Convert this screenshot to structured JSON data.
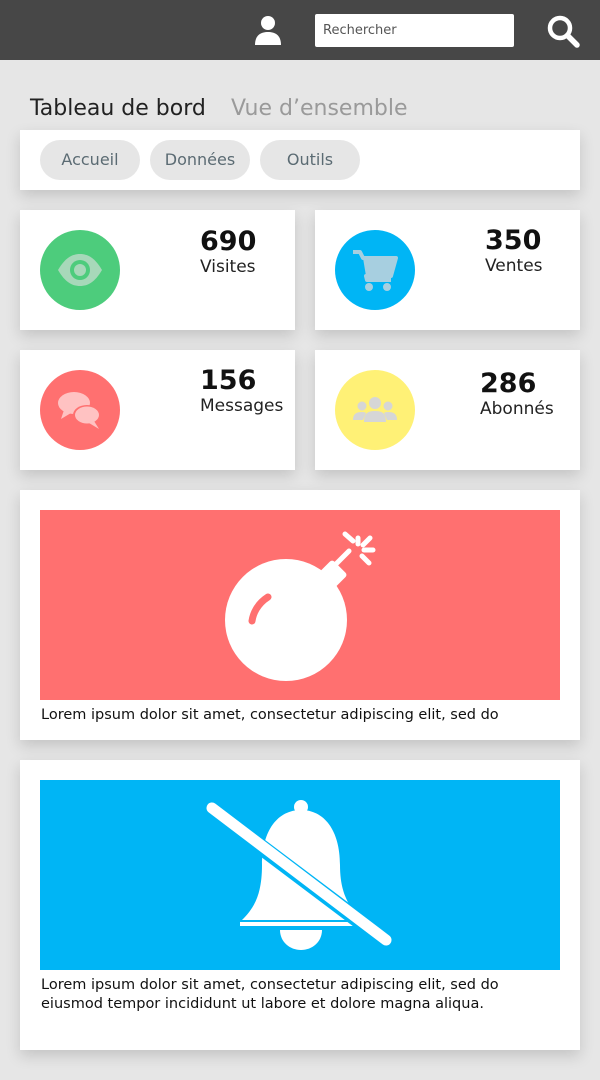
{
  "header": {
    "search_placeholder": "Rechercher",
    "user_icon": "user-icon",
    "search_icon": "search-icon"
  },
  "page": {
    "title": "Tableau de bord",
    "subtitle": "Vue d’ensemble"
  },
  "tabs": [
    {
      "label": "Accueil"
    },
    {
      "label": "Données"
    },
    {
      "label": "Outils"
    }
  ],
  "stats": [
    {
      "value": "690",
      "label": "Visites",
      "icon": "eye-icon",
      "color": "#4dcc7c"
    },
    {
      "value": "350",
      "label": "Ventes",
      "icon": "cart-icon",
      "color": "#00b5f5"
    },
    {
      "value": "156",
      "label": "Messages",
      "icon": "chat-icon",
      "color": "#ff7070"
    },
    {
      "value": "286",
      "label": "Abonnés",
      "icon": "group-icon",
      "color": "#fff176"
    }
  ],
  "cards": [
    {
      "icon": "bomb-icon",
      "color": "#ff7070",
      "text": "Lorem ipsum dolor sit amet, consectetur adipiscing elit, sed do"
    },
    {
      "icon": "bell-slash-icon",
      "color": "#00b5f5",
      "text": "Lorem ipsum dolor sit amet, consectetur adipiscing elit, sed do eiusmod tempor incididunt ut labore et dolore magna aliqua."
    }
  ]
}
